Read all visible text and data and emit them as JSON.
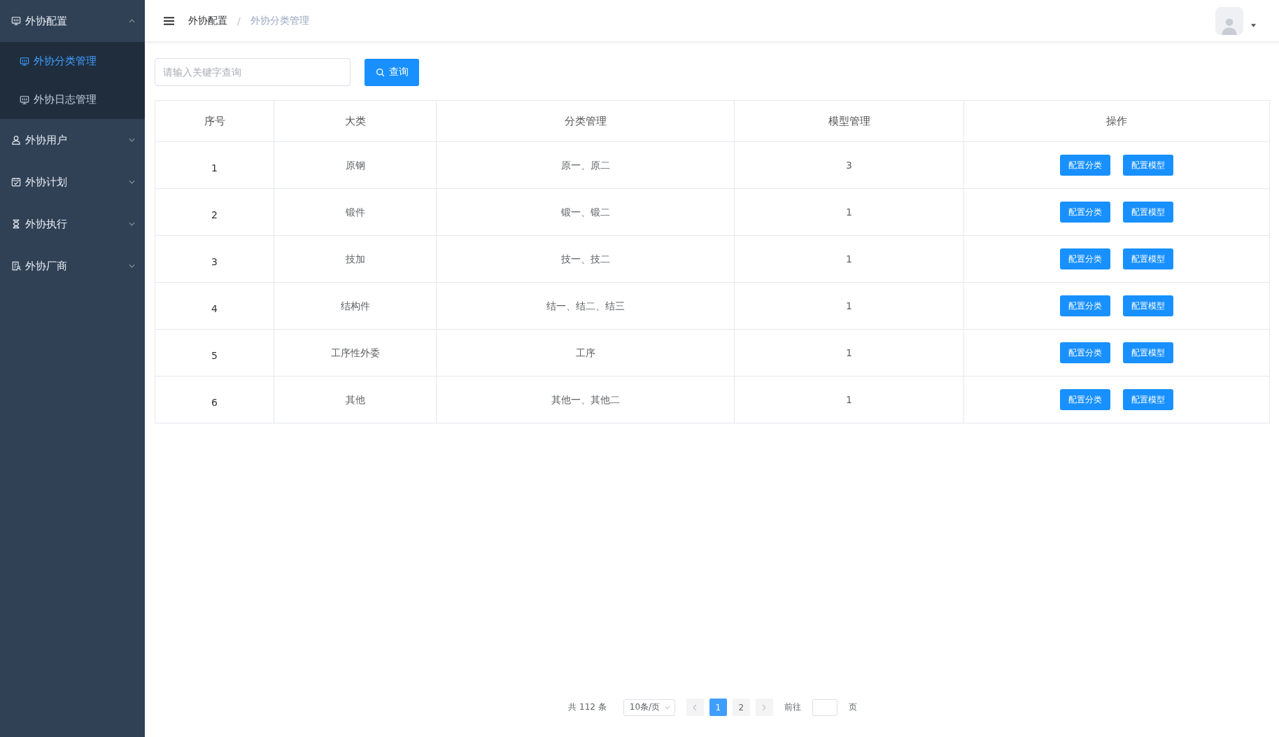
{
  "sidebar": {
    "groups": [
      {
        "label": "外协配置",
        "expanded": true,
        "children": [
          {
            "label": "外协分类管理",
            "selected": true
          },
          {
            "label": "外协日志管理",
            "selected": false
          }
        ]
      },
      {
        "label": "外协用户",
        "expanded": false
      },
      {
        "label": "外协计划",
        "expanded": false
      },
      {
        "label": "外协执行",
        "expanded": false
      },
      {
        "label": "外协厂商",
        "expanded": false
      }
    ]
  },
  "breadcrumb": [
    "外协配置",
    "/",
    "外协分类管理"
  ],
  "search": {
    "placeholder": "请输入关键字查询",
    "button": "查询"
  },
  "table": {
    "columns": [
      "序号",
      "大类",
      "分类管理",
      "模型管理",
      "操作"
    ],
    "rows": [
      {
        "cells": [
          "1",
          "原钢",
          "原一、原二",
          "3"
        ],
        "actions": [
          "配置分类",
          "配置模型"
        ]
      },
      {
        "cells": [
          "2",
          "锻件",
          "锻一、锻二",
          "1"
        ],
        "actions": [
          "配置分类",
          "配置模型"
        ]
      },
      {
        "cells": [
          "3",
          "技加",
          "技一、技二",
          "1"
        ],
        "actions": [
          "配置分类",
          "配置模型"
        ]
      },
      {
        "cells": [
          "4",
          "结构件",
          "结一、结二、结三",
          "1"
        ],
        "actions": [
          "配置分类",
          "配置模型"
        ]
      },
      {
        "cells": [
          "5",
          "工序性外委",
          "工序",
          "1"
        ],
        "actions": [
          "配置分类",
          "配置模型"
        ]
      },
      {
        "cells": [
          "6",
          "其他",
          "其他一、其他二",
          "1"
        ],
        "actions": [
          "配置分类",
          "配置模型"
        ]
      }
    ]
  },
  "pagination": {
    "total": "共 112 条",
    "page_size": "10条/页",
    "pages": [
      {
        "label": "1",
        "selected": true
      },
      {
        "label": "2",
        "selected": false
      }
    ],
    "goto_label": "前往",
    "goto_suffix": "页"
  }
}
